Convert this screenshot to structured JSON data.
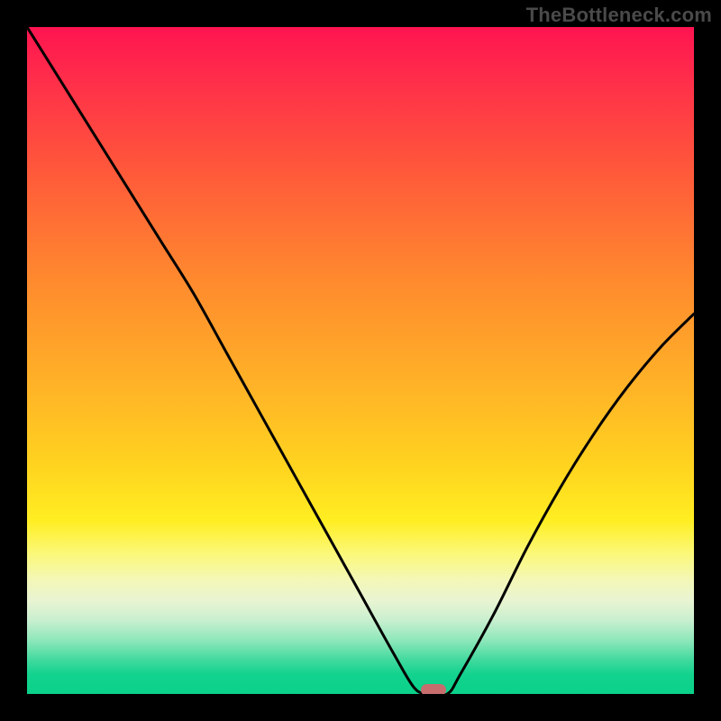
{
  "watermark": "TheBottleneck.com",
  "chart_data": {
    "type": "line",
    "title": "",
    "xlabel": "",
    "ylabel": "",
    "xlim": [
      0,
      100
    ],
    "ylim": [
      0,
      100
    ],
    "grid": false,
    "legend": false,
    "background": {
      "gradient": "vertical",
      "stops": [
        {
          "pos": 0,
          "color": "#ff1450"
        },
        {
          "pos": 22,
          "color": "#ff5a3a"
        },
        {
          "pos": 54,
          "color": "#ffb327"
        },
        {
          "pos": 74,
          "color": "#ffee22"
        },
        {
          "pos": 95,
          "color": "#3fd99d"
        },
        {
          "pos": 100,
          "color": "#0ad18a"
        }
      ]
    },
    "series": [
      {
        "name": "bottleneck-curve",
        "color": "#000000",
        "x": [
          0,
          5,
          10,
          15,
          20,
          25,
          30,
          35,
          40,
          45,
          50,
          55,
          58,
          60,
          63,
          65,
          70,
          75,
          80,
          85,
          90,
          95,
          100
        ],
        "values": [
          100,
          92,
          84,
          76,
          68,
          60,
          51,
          42,
          33,
          24,
          15,
          6,
          1,
          0,
          0,
          3,
          12,
          22,
          31,
          39,
          46,
          52,
          57
        ]
      }
    ],
    "marker": {
      "name": "optimal-point",
      "x": 61,
      "y": 0,
      "color": "#c76d6d",
      "shape": "pill"
    }
  }
}
